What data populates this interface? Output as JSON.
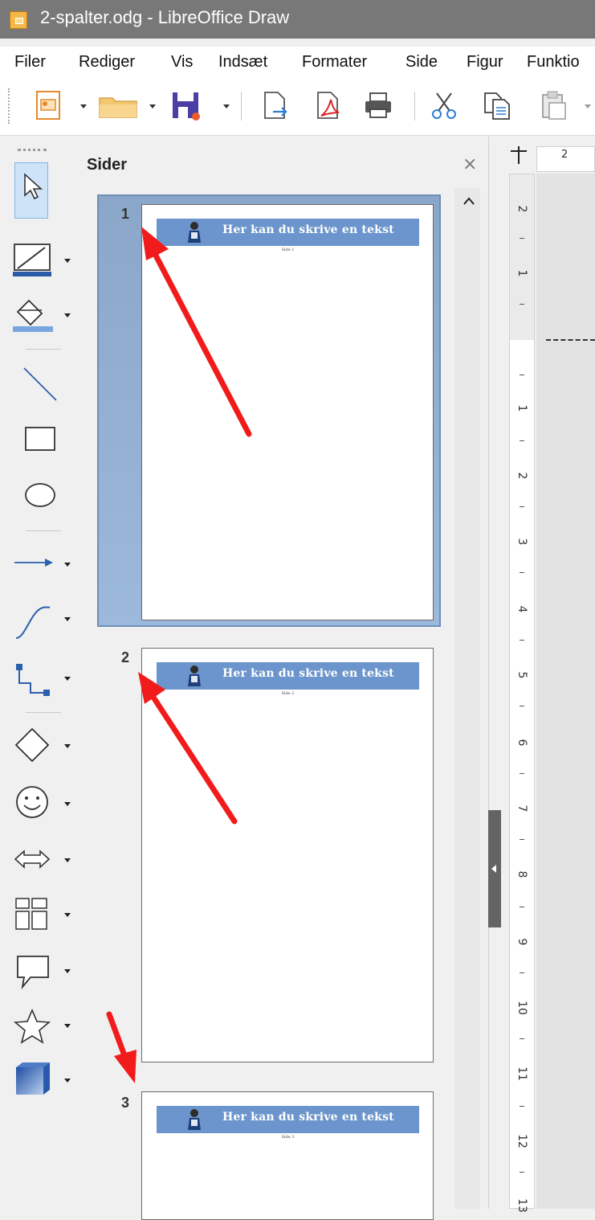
{
  "window": {
    "title": "2-spalter.odg - LibreOffice Draw"
  },
  "menu": [
    "Filer",
    "Rediger",
    "Vis",
    "Indsæt",
    "Formater",
    "Side",
    "Figur",
    "Funktio"
  ],
  "toolbar": {
    "icons": [
      "templates-icon",
      "open-folder-icon",
      "save-icon",
      "export-icon",
      "export-pdf-icon",
      "print-icon",
      "cut-icon",
      "copy-icon",
      "paste-icon"
    ]
  },
  "left_toolbar": {
    "icons": [
      "select-arrow-icon",
      "line-color-icon",
      "fill-color-icon",
      "line-icon",
      "rectangle-icon",
      "ellipse-icon",
      "line-arrow-icon",
      "curve-icon",
      "connector-icon",
      "basic-shapes-icon",
      "symbol-shapes-icon",
      "block-arrows-icon",
      "flowchart-icon",
      "callouts-icon",
      "stars-icon",
      "3d-objects-icon"
    ]
  },
  "pages_panel": {
    "title": "Sider",
    "close_glyph": "×",
    "pages": [
      {
        "number": "1",
        "heading": "Her kan du skrive en tekst",
        "subtitle": "Side 1",
        "selected": true
      },
      {
        "number": "2",
        "heading": "Her kan du skrive en tekst",
        "subtitle": "Side 2",
        "selected": false
      },
      {
        "number": "3",
        "heading": "Her kan du skrive en tekst",
        "subtitle": "Side 3",
        "selected": false
      }
    ]
  },
  "rulers": {
    "horizontal": [
      "2"
    ],
    "vertical": [
      "2",
      "1",
      "1",
      "2",
      "3",
      "4",
      "5",
      "6",
      "7",
      "8",
      "9",
      "10",
      "11",
      "12",
      "13"
    ]
  },
  "colors": {
    "accent_band": "#6b95cc",
    "selection": "#8aa6c8",
    "annotation_arrow": "#f21b1b"
  }
}
